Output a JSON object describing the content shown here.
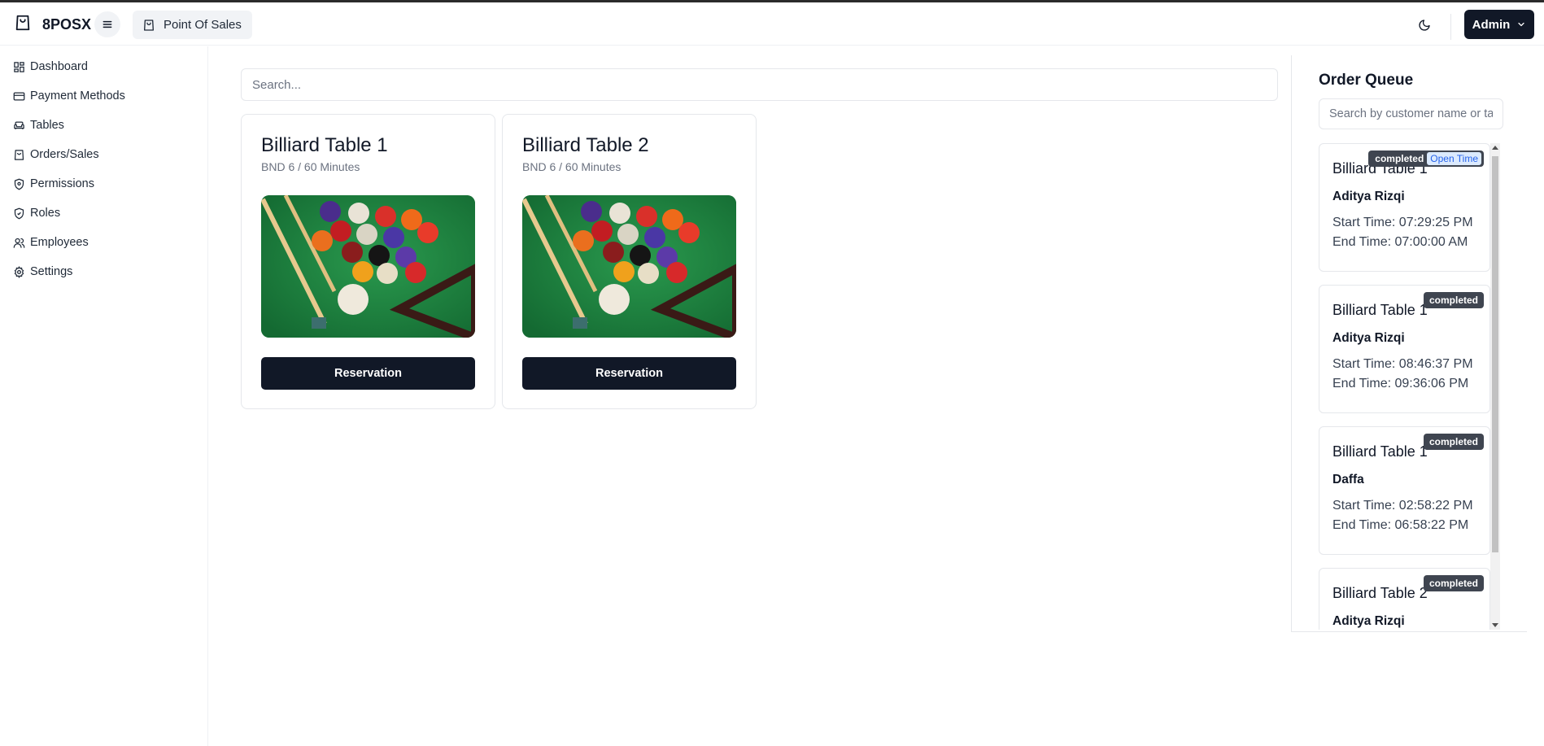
{
  "app": {
    "brand": "8POSX",
    "pos_button": "Point Of Sales",
    "admin_button": "Admin"
  },
  "sidebar": {
    "items": [
      {
        "label": "Dashboard",
        "icon": "dashboard-icon"
      },
      {
        "label": "Payment Methods",
        "icon": "credit-card-icon"
      },
      {
        "label": "Tables",
        "icon": "sofa-icon"
      },
      {
        "label": "Orders/Sales",
        "icon": "shopping-bag-icon"
      },
      {
        "label": "Permissions",
        "icon": "shield-icon"
      },
      {
        "label": "Roles",
        "icon": "shield-check-icon"
      },
      {
        "label": "Employees",
        "icon": "users-icon"
      },
      {
        "label": "Settings",
        "icon": "gear-icon"
      }
    ]
  },
  "main": {
    "search_placeholder": "Search...",
    "tables": [
      {
        "name": "Billiard Table 1",
        "price": "BND 6 / 60 Minutes",
        "button": "Reservation"
      },
      {
        "name": "Billiard Table 2",
        "price": "BND 6 / 60 Minutes",
        "button": "Reservation"
      }
    ]
  },
  "queue": {
    "title": "Order Queue",
    "search_placeholder": "Search by customer name or table",
    "orders": [
      {
        "table": "Billiard Table 1",
        "customer": "Aditya Rizqi",
        "start": "Start Time: 07:29:25 PM",
        "end": "End Time: 07:00:00 AM",
        "status": "completed",
        "tag": "Open Time"
      },
      {
        "table": "Billiard Table 1",
        "customer": "Aditya Rizqi",
        "start": "Start Time: 08:46:37 PM",
        "end": "End Time: 09:36:06 PM",
        "status": "completed"
      },
      {
        "table": "Billiard Table 1",
        "customer": "Daffa",
        "start": "Start Time: 02:58:22 PM",
        "end": "End Time: 06:58:22 PM",
        "status": "completed"
      },
      {
        "table": "Billiard Table 2",
        "customer": "Aditya Rizqi",
        "start": "",
        "end": "",
        "status": "completed"
      }
    ]
  },
  "colors": {
    "primary": "#111827",
    "badge": "#3f4550",
    "felt": "#1f7a3d"
  }
}
